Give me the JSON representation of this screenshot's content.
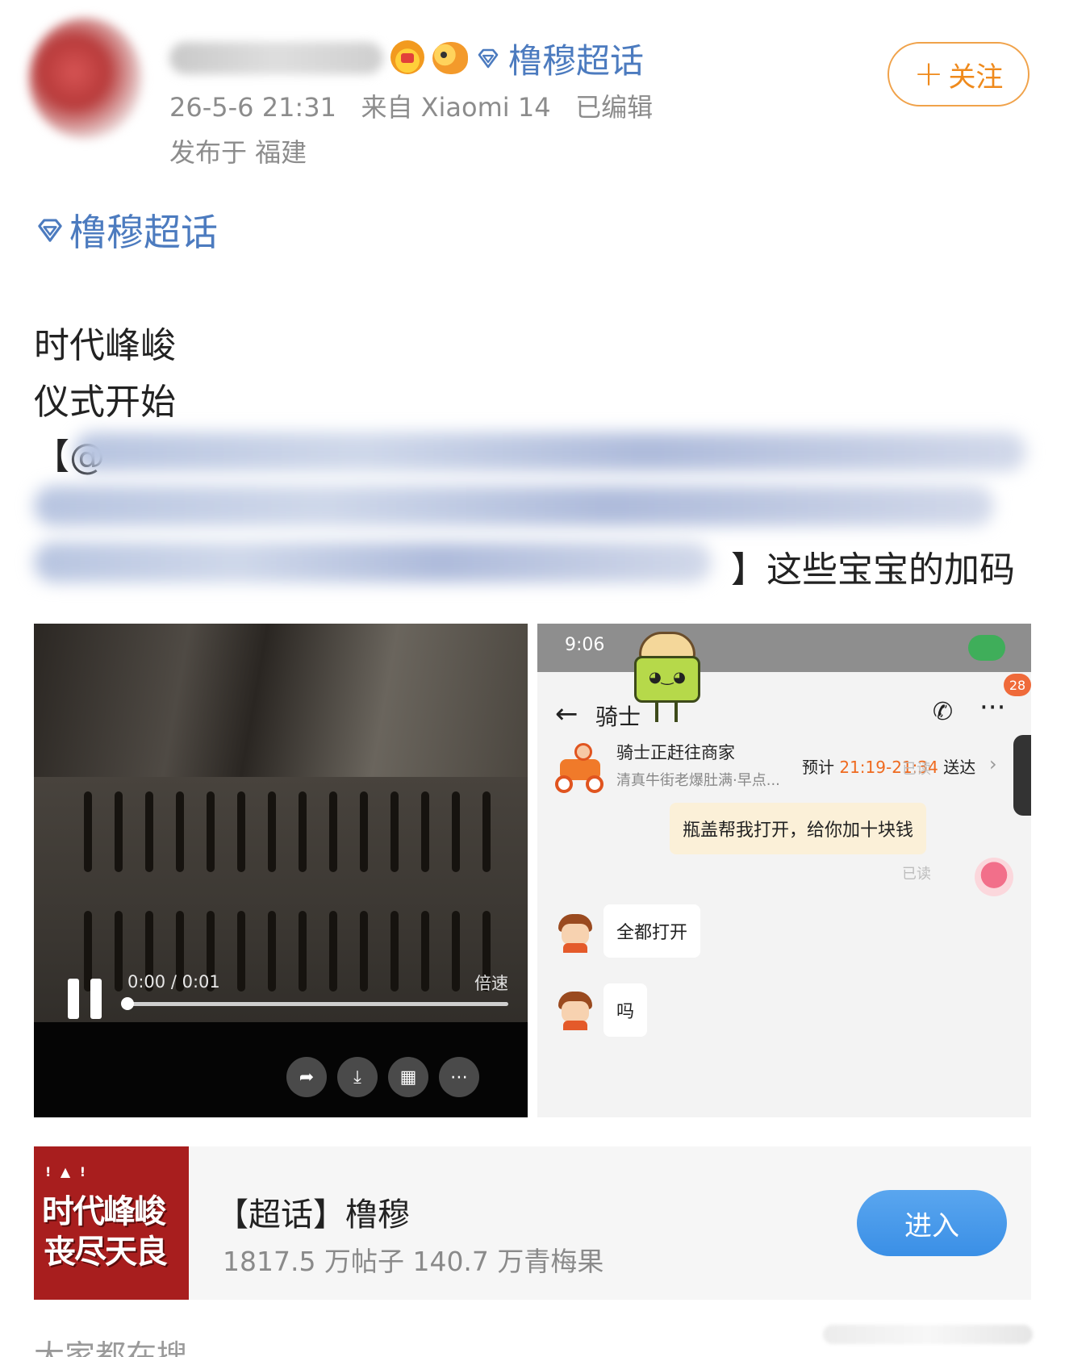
{
  "post": {
    "topic_header": "橹穆超话",
    "timestamp": "26-5-6 21:31",
    "source": "来自 Xiaomi 14",
    "edited": "已编辑",
    "location": "发布于 福建",
    "follow_label": "关注",
    "topic_tag": "橹穆超话",
    "lines": [
      "时代峰峻",
      "仪式开始"
    ],
    "mention_open": "【@",
    "mention_close": "】这些宝宝的加码"
  },
  "video": {
    "time": "0:00 / 0:01",
    "speed_label": "倍速",
    "progress": 0.0
  },
  "chat": {
    "clock": "9:06",
    "title": "骑士",
    "badge": "28",
    "order_title": "骑士正赶往商家",
    "order_sub": "清真牛街老爆肚满·早点...",
    "eta_prefix": "预计 ",
    "eta_time": "21:19-21:34",
    "eta_suffix": " 送达",
    "read_label": "已读",
    "my_message": "瓶盖帮我打开，给你加十块钱",
    "reply1": "全都打开",
    "reply2": "吗"
  },
  "card": {
    "cover_line1": "时代峰峻",
    "cover_line2": "丧尽天良",
    "title": "【超话】橹穆",
    "stats": "1817.5 万帖子 140.7 万青梅果",
    "enter_label": "进入"
  },
  "footer": {
    "cut_text": "大家都在搜"
  },
  "colors": {
    "link": "#4c7bbf",
    "follow": "#ef8a1c",
    "enter": "#3a8fe6",
    "eta": "#ef6a1f"
  },
  "icons": [
    "diamond-icon",
    "crown-badge-icon",
    "fish-badge-icon",
    "pause-icon",
    "share-icon",
    "download-icon",
    "grid-icon",
    "more-icon",
    "back-icon",
    "phone-icon"
  ]
}
